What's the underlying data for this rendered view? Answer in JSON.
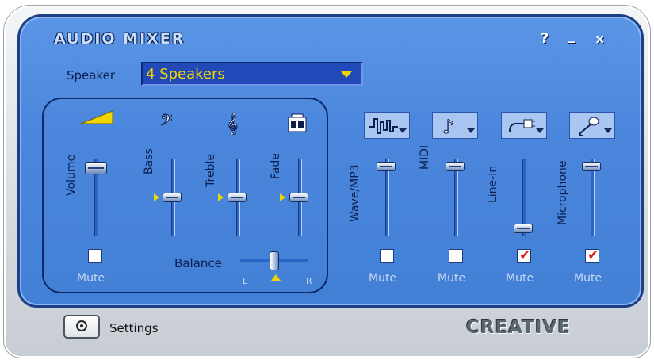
{
  "window": {
    "title": "AUDIO MIXER",
    "help_label": "?",
    "minimize_label": "_",
    "close_label": "×"
  },
  "speaker": {
    "label": "Speaker",
    "selected": "4 Speakers"
  },
  "master": {
    "volume_label": "Volume",
    "volume_level": 0.95,
    "bass_label": "Bass",
    "bass_level": 0.5,
    "treble_label": "Treble",
    "treble_level": 0.5,
    "fade_label": "Fade",
    "fade_level": 0.5,
    "mute_label": "Mute",
    "mute_checked": false,
    "balance_label": "Balance",
    "balance_level": 0.5,
    "balance_left": "L",
    "balance_right": "R"
  },
  "channels": [
    {
      "label": "Wave/MP3",
      "icon": "waveform-icon",
      "level": 0.95,
      "mute_label": "Mute",
      "muted": false
    },
    {
      "label": "MIDI",
      "icon": "music-note-icon",
      "level": 0.95,
      "mute_label": "Mute",
      "muted": false
    },
    {
      "label": "Line-In",
      "icon": "line-in-plug-icon",
      "level": 0.05,
      "mute_label": "Mute",
      "muted": true
    },
    {
      "label": "Microphone",
      "icon": "microphone-icon",
      "level": 0.95,
      "mute_label": "Mute",
      "muted": true
    }
  ],
  "footer": {
    "settings_label": "Settings",
    "brand": "CREATIVE"
  },
  "colors": {
    "panel": "#4a86dc",
    "border": "#1d3f86",
    "accent": "#f2d400",
    "mute_check": "#d42121"
  }
}
